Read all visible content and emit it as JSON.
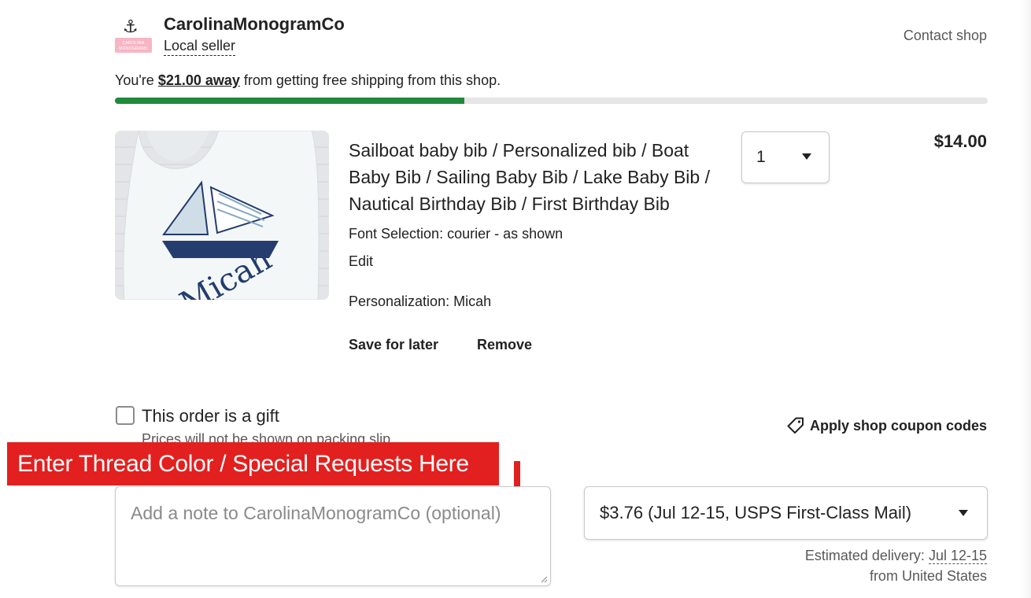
{
  "shop": {
    "name": "CarolinaMonogramCo",
    "badge": "Local seller",
    "contact_label": "Contact shop",
    "logo_icon": "anchor-icon"
  },
  "free_shipping": {
    "prefix": "You're ",
    "amount": "$21.00 away",
    "suffix": " from getting free shipping from this shop.",
    "progress_fraction": 0.4,
    "bar_color": "#1f8b3a"
  },
  "item": {
    "title": "Sailboat baby bib / Personalized bib / Boat Baby Bib / Sailing Baby Bib / Lake Baby Bib / Nautical Birthday Bib / First Birthday Bib",
    "font_selection": "Font Selection: courier - as shown",
    "edit_label": "Edit",
    "personalization": "Personalization: Micah",
    "image_text": "Micah",
    "save_for_later_label": "Save for later",
    "remove_label": "Remove",
    "quantity": "1",
    "price": "$14.00"
  },
  "gift": {
    "label": "This order is a gift",
    "sublabel": "Prices will not be shown on packing slip",
    "checked": false
  },
  "coupon": {
    "label": "Apply shop coupon codes",
    "icon": "tag-icon"
  },
  "annotation": {
    "banner_text": "Enter Thread Color / Special Requests Here",
    "banner_color": "#e2201f"
  },
  "note": {
    "placeholder": "Add a note to CarolinaMonogramCo (optional)"
  },
  "shipping": {
    "selected": "$3.76 (Jul 12-15, USPS First-Class Mail)",
    "estimated_prefix": "Estimated delivery: ",
    "estimated_date": "Jul 12-15",
    "origin": "from United States"
  }
}
